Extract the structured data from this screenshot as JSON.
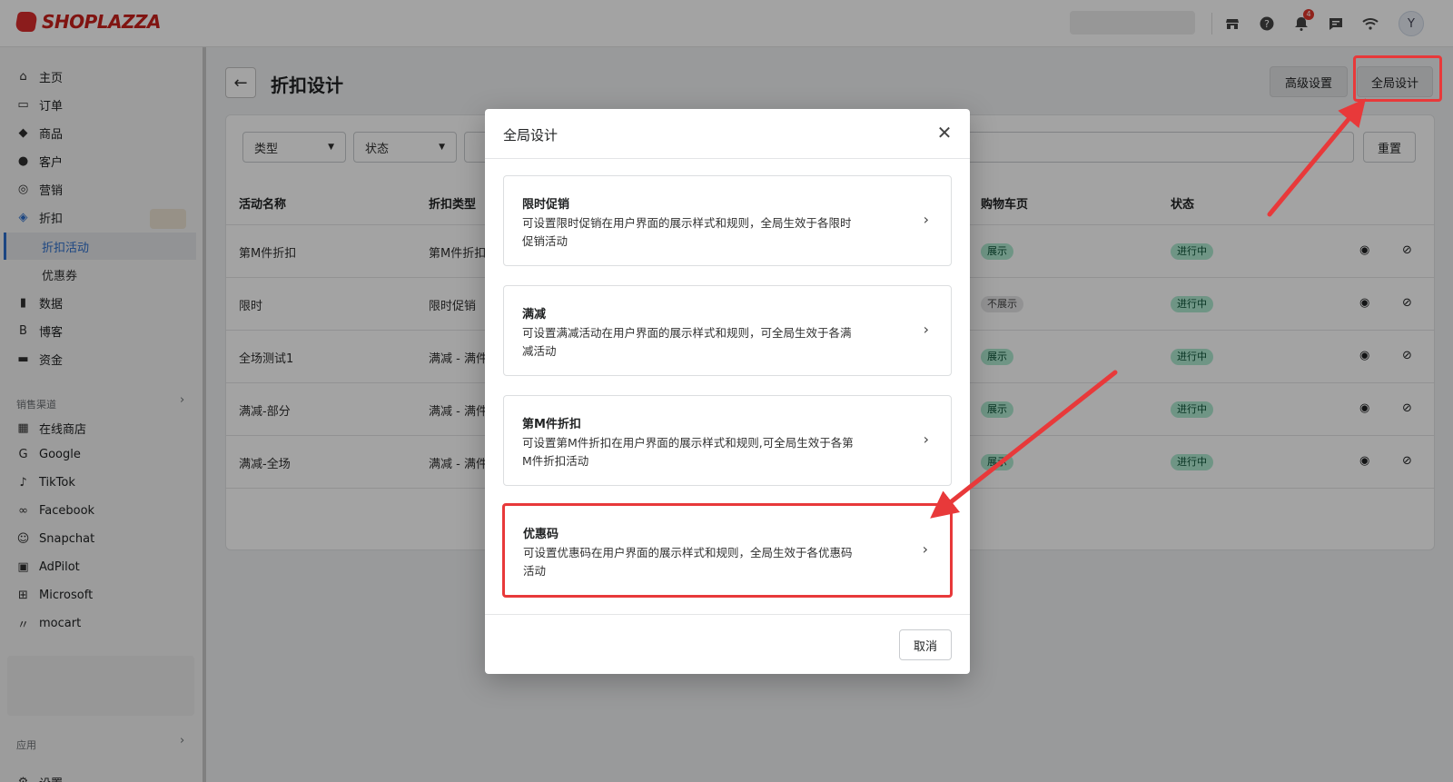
{
  "brand": {
    "name": "SHOPLAZZA"
  },
  "topbar": {
    "notification_count": "4",
    "avatar_letter": "Y",
    "icons": [
      "store-icon",
      "help-icon",
      "bell-icon",
      "chat-icon",
      "wifi-icon"
    ]
  },
  "sidebar": {
    "items": [
      {
        "label": "主页",
        "icon": "home-icon"
      },
      {
        "label": "订单",
        "icon": "inbox-icon"
      },
      {
        "label": "商品",
        "icon": "tag-icon"
      },
      {
        "label": "客户",
        "icon": "person-icon"
      },
      {
        "label": "营销",
        "icon": "target-icon"
      },
      {
        "label": "折扣",
        "icon": "discount-icon"
      }
    ],
    "discount_sub": [
      "折扣活动",
      "优惠券"
    ],
    "items2": [
      {
        "label": "数据",
        "icon": "chart-icon"
      },
      {
        "label": "博客",
        "icon": "blog-icon"
      },
      {
        "label": "资金",
        "icon": "wallet-icon"
      }
    ],
    "sales_channel_label": "销售渠道",
    "channels": [
      {
        "label": "在线商店",
        "icon": "store-icon"
      },
      {
        "label": "Google",
        "icon": "google-icon"
      },
      {
        "label": "TikTok",
        "icon": "tiktok-icon"
      },
      {
        "label": "Facebook",
        "icon": "meta-icon"
      },
      {
        "label": "Snapchat",
        "icon": "snapchat-icon"
      },
      {
        "label": "AdPilot",
        "icon": "adpilot-icon"
      },
      {
        "label": "Microsoft",
        "icon": "microsoft-icon"
      },
      {
        "label": "mocart",
        "icon": "mocart-icon"
      }
    ],
    "apps_label": "应用",
    "settings_label": "设置"
  },
  "page": {
    "title": "折扣设计",
    "advanced_button": "高级设置",
    "global_button": "全局设计",
    "filters": {
      "type": "类型",
      "status": "状态"
    },
    "reset_button": "重置",
    "columns": {
      "name": "活动名称",
      "type": "折扣类型",
      "cart": "购物车页",
      "status": "状态"
    },
    "rows": [
      {
        "name": "第M件折扣",
        "type": "第M件折扣",
        "cart": "展示",
        "status": "进行中"
      },
      {
        "name": "限时",
        "type": "限时促销",
        "cart": "不展示",
        "status": "进行中"
      },
      {
        "name": "全场测试1",
        "type": "满减 - 满件",
        "cart": "展示",
        "status": "进行中"
      },
      {
        "name": "满减-部分",
        "type": "满减 - 满件",
        "cart": "展示",
        "status": "进行中"
      },
      {
        "name": "满减-全场",
        "type": "满减 - 满件",
        "cart": "展示",
        "status": "进行中"
      }
    ]
  },
  "modal": {
    "title": "全局设计",
    "options": [
      {
        "title": "限时促销",
        "desc": "可设置限时促销在用户界面的展示样式和规则，全局生效于各限时促销活动"
      },
      {
        "title": "满减",
        "desc": "可设置满减活动在用户界面的展示样式和规则，可全局生效于各满减活动"
      },
      {
        "title": "第M件折扣",
        "desc": "可设置第M件折扣在用户界面的展示样式和规则,可全局生效于各第M件折扣活动"
      },
      {
        "title": "优惠码",
        "desc": "可设置优惠码在用户界面的展示样式和规则，全局生效于各优惠码活动"
      }
    ],
    "cancel": "取消"
  },
  "colors": {
    "accent_red": "#e8393a",
    "brand_red": "#c8201c",
    "pill_green": "#aee9d1",
    "active_blue": "#2c6ecb"
  }
}
